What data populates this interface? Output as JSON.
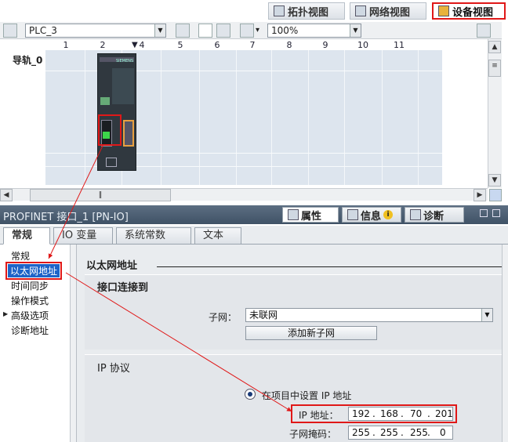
{
  "views": {
    "topology": "拓扑视图",
    "network": "网络视图",
    "device": "设备视图"
  },
  "toolbar": {
    "device_select": "PLC_3",
    "zoom": "100%"
  },
  "canvas": {
    "rail_label": "导轨_0",
    "slot_numbers": [
      "1",
      "2",
      "4",
      "5",
      "6",
      "7",
      "8",
      "9",
      "10",
      "11"
    ],
    "module_brand": "SIEMENS"
  },
  "inspector": {
    "title": "PROFINET 接口_1 [PN-IO]",
    "tabs": {
      "properties": "属性",
      "info": "信息",
      "diagnostics": "诊断"
    },
    "subtabs": [
      "常规",
      "IO 变量",
      "系统常数",
      "文本"
    ],
    "nav": [
      "常规",
      "以太网地址",
      "时间同步",
      "操作模式",
      "高级选项",
      "诊断地址"
    ],
    "section_title": "以太网地址",
    "iface": {
      "title": "接口连接到",
      "subnet_label": "子网：",
      "subnet_value": "未联网",
      "add_subnet_button": "添加新子网"
    },
    "ip": {
      "title": "IP 协议",
      "radio_label": "在项目中设置 IP 地址",
      "ip_label": "IP 地址：",
      "ip_octets": [
        "192",
        "168",
        "70",
        "201"
      ],
      "mask_label": "子网掩码：",
      "mask_octets": [
        "255",
        "255",
        "255",
        "0"
      ]
    }
  },
  "colors": {
    "highlight": "#e01818",
    "selection": "#1e64c8",
    "header": "#4a5d72"
  }
}
